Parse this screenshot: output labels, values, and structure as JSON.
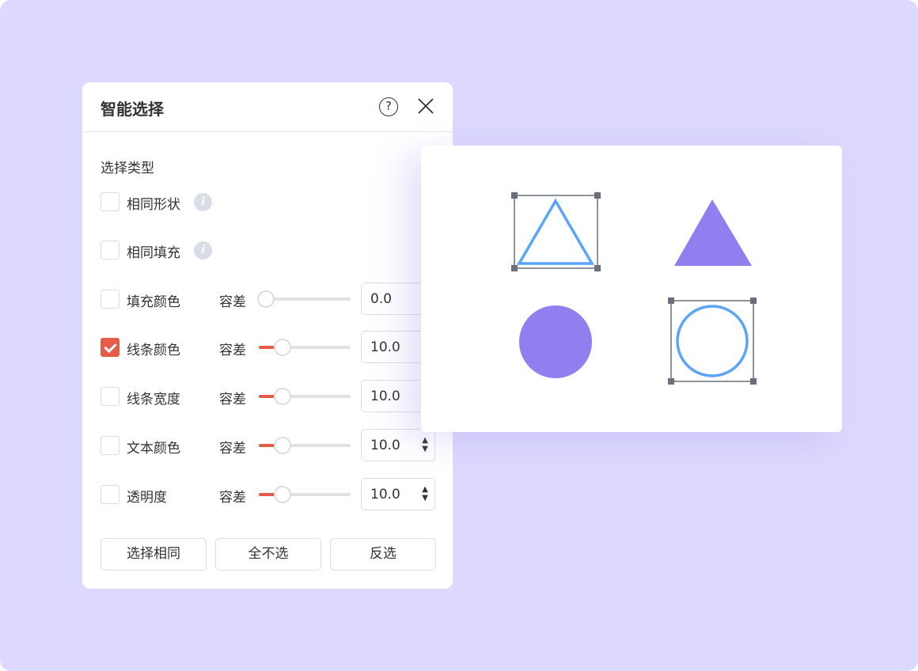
{
  "dialog": {
    "title": "智能选择",
    "help_icon": "?",
    "section": "选择类型",
    "options": [
      {
        "label": "相同形状",
        "checked": false,
        "info": "i"
      },
      {
        "label": "相同填充",
        "checked": false,
        "info": "i"
      },
      {
        "label": "填充颜色",
        "checked": false,
        "tolerance_label": "容差",
        "value": "0.0",
        "slider_fraction": 0
      },
      {
        "label": "线条颜色",
        "checked": true,
        "tolerance_label": "容差",
        "value": "10.0",
        "slider_fraction": 0.26
      },
      {
        "label": "线条宽度",
        "checked": false,
        "tolerance_label": "容差",
        "value": "10.0",
        "slider_fraction": 0.26
      },
      {
        "label": "文本颜色",
        "checked": false,
        "tolerance_label": "容差",
        "value": "10.0",
        "slider_fraction": 0.26
      },
      {
        "label": "透明度",
        "checked": false,
        "tolerance_label": "容差",
        "value": "10.0",
        "slider_fraction": 0.26
      }
    ],
    "buttons": {
      "select_same": "选择相同",
      "select_none": "全不选",
      "invert": "反选"
    }
  },
  "colors": {
    "accent": "#e65c4a",
    "background": "#ddd8fe",
    "shape_fill": "#917ff0",
    "shape_stroke": "#5aa5fa"
  }
}
